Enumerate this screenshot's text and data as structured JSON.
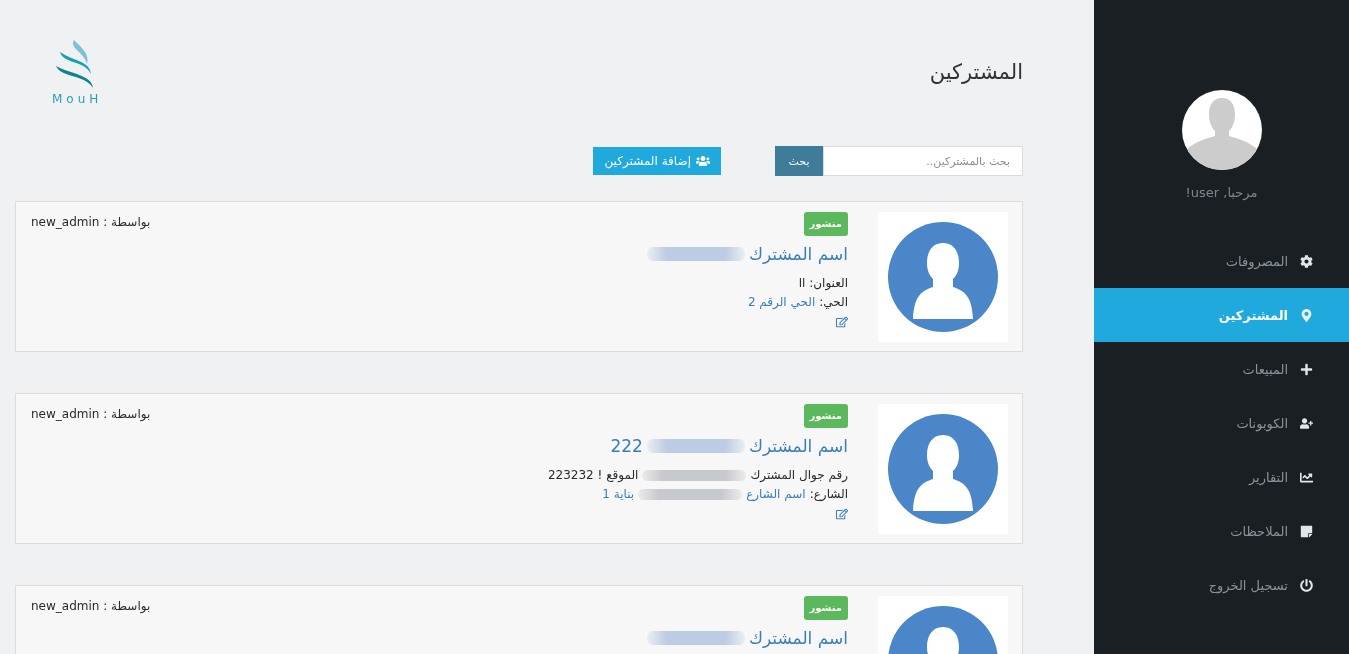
{
  "sidebar": {
    "greeting": "مرحبا, user!",
    "items": [
      {
        "label": "المصروفات",
        "selected": false
      },
      {
        "label": "المشتركين",
        "selected": true
      },
      {
        "label": "المبيعات",
        "selected": false
      },
      {
        "label": "الكوبونات",
        "selected": false
      },
      {
        "label": "التقارير",
        "selected": false
      },
      {
        "label": "الملاحظات",
        "selected": false
      },
      {
        "label": "تسجيل الخروج",
        "selected": false
      }
    ]
  },
  "header": {
    "title": "المشتركين",
    "logo_text": "MouH"
  },
  "toolbar": {
    "search": {
      "placeholder": "بحث بالمشتركين..",
      "button": "بحث"
    },
    "add_button": "إضافة المشتركين"
  },
  "cards": [
    {
      "badge": "منشور",
      "author": "بواسطة : new_admin",
      "title": [
        {
          "kind": "text",
          "text": "اسم المشترك"
        },
        {
          "kind": "blurred"
        }
      ],
      "lines": [
        [
          {
            "kind": "text",
            "text": "العنوان: اا"
          }
        ],
        [
          {
            "kind": "text",
            "text": "الحي:"
          },
          {
            "kind": "link",
            "text": "الحي الرقم 2"
          }
        ]
      ]
    },
    {
      "badge": "منشور",
      "author": "بواسطة : new_admin",
      "title": [
        {
          "kind": "text",
          "text": "اسم المشترك"
        },
        {
          "kind": "blurred"
        },
        {
          "kind": "text",
          "text": "222"
        }
      ],
      "lines": [
        [
          {
            "kind": "text",
            "text": "رقم جوال المشترك"
          },
          {
            "kind": "blurred"
          },
          {
            "kind": "text",
            "text": "الموقع ! 223232"
          }
        ],
        [
          {
            "kind": "text",
            "text": "الشارع:"
          },
          {
            "kind": "link",
            "text": "اسم الشارع"
          },
          {
            "kind": "blurred"
          },
          {
            "kind": "link",
            "text": "بناية 1"
          }
        ]
      ]
    },
    {
      "badge": "منشور",
      "author": "بواسطة : new_admin",
      "title": [
        {
          "kind": "text",
          "text": "اسم المشترك"
        },
        {
          "kind": "blurred"
        }
      ]
    }
  ]
}
